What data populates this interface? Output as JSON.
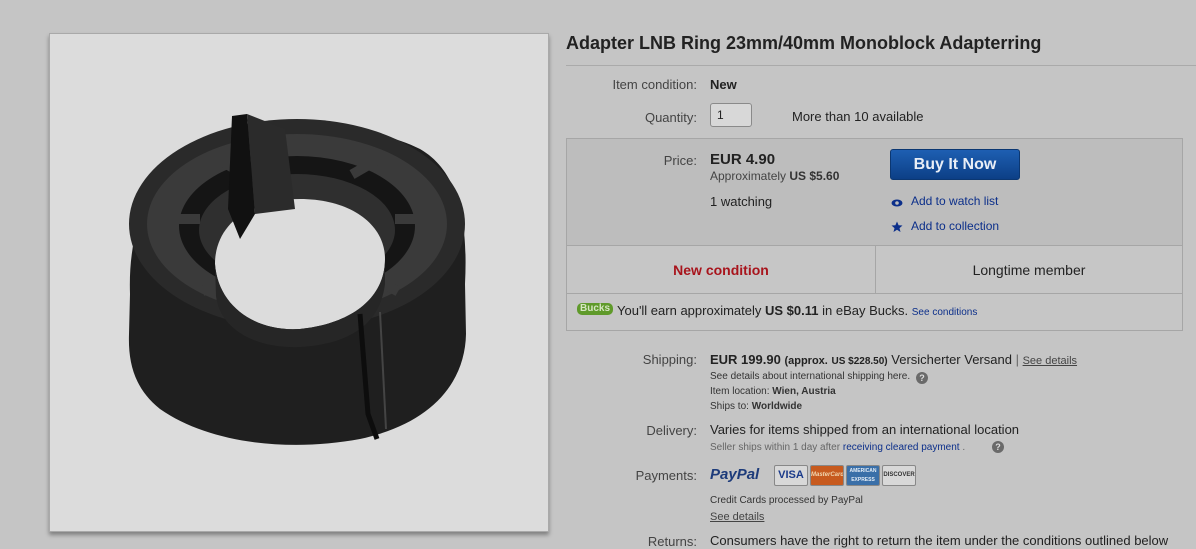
{
  "product": {
    "title": "Adapter LNB Ring 23mm/40mm Monoblock Adapterring",
    "image_alt": "Black plastic LNB adapter ring"
  },
  "condition": {
    "label": "Item condition:",
    "value": "New"
  },
  "quantity": {
    "label": "Quantity:",
    "value": "1",
    "available": "More than 10 available"
  },
  "price": {
    "label": "Price:",
    "amount": "EUR 4.90",
    "approx_prefix": "Approximately",
    "approx_value": "US $5.60",
    "watching": "1 watching"
  },
  "actions": {
    "buy_now": "Buy It Now",
    "watch_list": "Add to watch list",
    "collection": "Add to collection"
  },
  "badges": {
    "new_condition": "New condition",
    "longtime_member": "Longtime member"
  },
  "bucks": {
    "badge": "Bucks",
    "text_prefix": "You'll earn approximately",
    "amount": "US $0.11",
    "text_suffix": "in eBay Bucks.",
    "link": "See conditions"
  },
  "shipping": {
    "label": "Shipping:",
    "amount": "EUR 199.90",
    "approx_prefix": "(approx.",
    "approx_value": "US $228.50)",
    "method": "Versicherter Versand",
    "separator": "|",
    "details_link": "See details",
    "intl_note": "See details about international shipping here.",
    "location_label": "Item location:",
    "location_value": "Wien, Austria",
    "ships_to_label": "Ships to:",
    "ships_to_value": "Worldwide"
  },
  "delivery": {
    "label": "Delivery:",
    "value": "Varies for items shipped from an international location",
    "note_prefix": "Seller ships within 1 day after",
    "note_link": "receiving cleared payment",
    "note_suffix": "."
  },
  "payments": {
    "label": "Payments:",
    "paypal": "PayPal",
    "cards": [
      "VISA",
      "MasterCard",
      "AMERICAN EXPRESS",
      "DISCOVER"
    ],
    "note": "Credit Cards processed by PayPal",
    "details_link": "See details"
  },
  "returns": {
    "label": "Returns:",
    "value": "Consumers have the right to return the item under the conditions outlined below"
  },
  "colors": {
    "buy_button": "#1e5fb2",
    "new_condition": "#a8141c",
    "link": "#0c2f8a",
    "bucks": "#5f9a2a"
  }
}
